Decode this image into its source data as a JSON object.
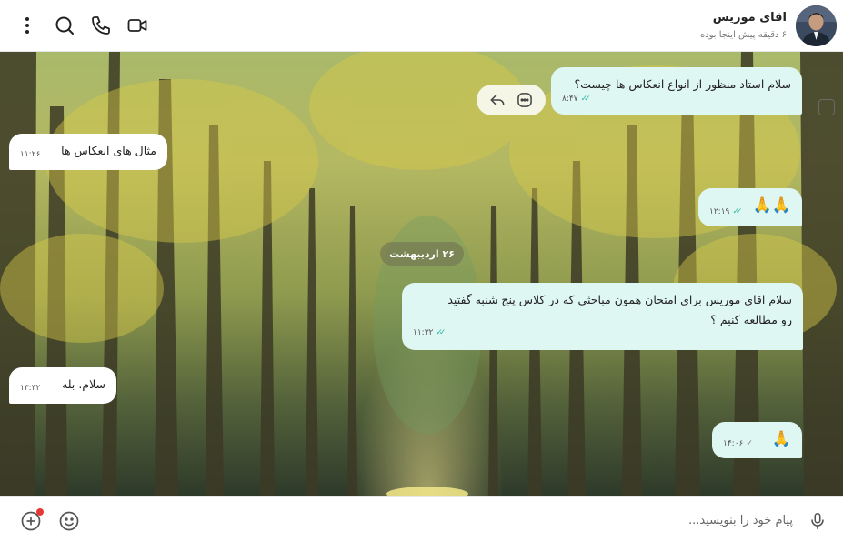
{
  "contact": {
    "name": "اقای موریس",
    "status": "۶ دقیقه پیش اینجا بوده"
  },
  "header_icons": [
    "more-vertical-icon",
    "search-icon",
    "phone-icon",
    "video-call-icon"
  ],
  "date_separator": "۲۶ اردیبهشت",
  "messages": [
    {
      "direction": "out",
      "text": [
        "سلام استاد منظور از انواع انعکاس ها چیست؟"
      ],
      "time": "۸:۴۷",
      "status": "read"
    },
    {
      "direction": "in",
      "text": [
        "مثال های انعکاس ها"
      ],
      "time": "۱۱:۲۶"
    },
    {
      "direction": "out",
      "text": [
        "🙏🙏"
      ],
      "time": "۱۲:۱۹",
      "status": "read"
    },
    {
      "direction": "out",
      "text": [
        "سلام اقای موریس برای امتحان همون مباحثی که در کلاس پنج شنبه  گفتید",
        "رو مطالعه کنیم ؟"
      ],
      "time": "۱۱:۳۲",
      "status": "read"
    },
    {
      "direction": "in",
      "text": [
        "سلام. بله"
      ],
      "time": "۱۳:۳۲"
    },
    {
      "direction": "out",
      "text": [
        "🙏"
      ],
      "time": "۱۴:۰۶",
      "status": "sent"
    }
  ],
  "message_actions": [
    "reply-icon",
    "more-options-icon"
  ],
  "composer": {
    "placeholder": "پیام خود را بنویسید..."
  },
  "colors": {
    "outgoing_bubble": "#dff7f3",
    "incoming_bubble": "#ffffff",
    "read_tick": "#2fb8a4",
    "notification_dot": "#e53935"
  }
}
